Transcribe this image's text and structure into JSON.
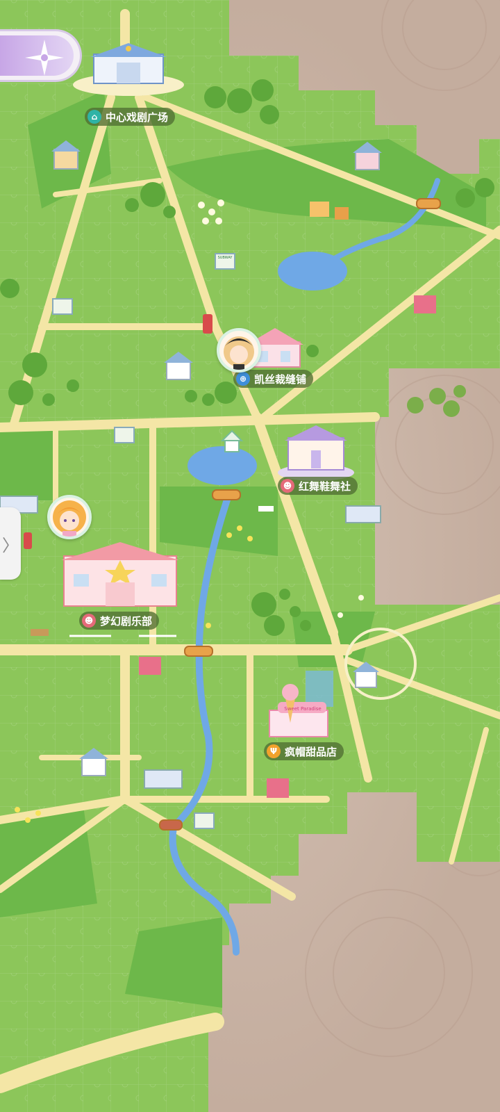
{
  "map": {
    "locations": [
      {
        "name": "中心戏剧广场",
        "icon": "museum-icon",
        "color": "#2fb3a6"
      },
      {
        "name": "凯丝裁缝铺",
        "icon": "bag-icon",
        "color": "#3f8fd9"
      },
      {
        "name": "红舞鞋舞社",
        "icon": "masks-icon",
        "color": "#e56a79"
      },
      {
        "name": "梦幻剧乐部",
        "icon": "masks-icon",
        "color": "#e56a79"
      },
      {
        "name": "疯帽甜品店",
        "icon": "fork-icon",
        "color": "#f2a22c"
      }
    ],
    "shop_sign": "SUBWAY",
    "bakery_sign": "Sweet Paradise"
  },
  "controls": {
    "compass_icon": "compass-star-icon",
    "side_tab_icon": "chevron-right-icon",
    "side_tab_glyph": "〉"
  },
  "colors": {
    "grass": "#8cc65a",
    "grass_dark": "#5fae3f",
    "road": "#f4e6a6",
    "water": "#6fa8e6",
    "fog": "#c9b4a6"
  }
}
